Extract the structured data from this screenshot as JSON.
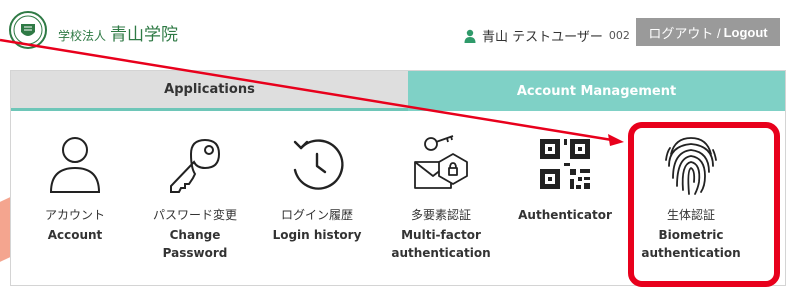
{
  "header": {
    "org_small": "学校法人",
    "org_name": "青山学院",
    "user_name": "青山 テストユーザー",
    "user_id": "002",
    "logout_jp": "ログアウト /",
    "logout_en": "Logout"
  },
  "tabs": {
    "applications": "Applications",
    "account_management": "Account Management"
  },
  "items": [
    {
      "jp": "アカウント",
      "en": "Account"
    },
    {
      "jp": "パスワード変更",
      "en": "Change\nPassword"
    },
    {
      "jp": "ログイン履歴",
      "en": "Login history"
    },
    {
      "jp": "多要素認証",
      "en": "Multi-factor\nauthentication"
    },
    {
      "jp": "",
      "en": "Authenticator"
    },
    {
      "jp": "生体認証",
      "en": "Biometric\nauthentication"
    }
  ],
  "colors": {
    "accent_teal": "#7fd1c6",
    "brand_green": "#2f7a45",
    "highlight_red": "#e8001c"
  },
  "icons": [
    "school-logo-icon",
    "user-icon",
    "account-icon",
    "key-icon",
    "history-icon",
    "mfa-icon",
    "qr-code-icon",
    "fingerprint-icon"
  ]
}
